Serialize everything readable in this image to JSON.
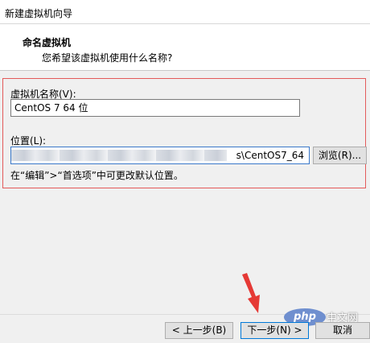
{
  "window": {
    "title": "新建虚拟机向导"
  },
  "header": {
    "title": "命名虚拟机",
    "subtitle": "您希望该虚拟机使用什么名称?"
  },
  "form": {
    "name_label": "虚拟机名称(V):",
    "name_value": "CentOS 7 64 位",
    "location_label": "位置(L):",
    "location_value": "s\\CentOS7_64",
    "browse_label": "浏览(R)...",
    "hint": "在“编辑”>“首选项”中可更改默认位置。"
  },
  "footer": {
    "back_label": "< 上一步(B)",
    "next_label": "下一步(N) >",
    "cancel_label": "取消"
  },
  "watermark": {
    "logo_text": "php",
    "site_text": "中文网"
  },
  "colors": {
    "highlight_border": "#e35a5a",
    "arrow": "#e53935",
    "focus": "#0078d7"
  }
}
